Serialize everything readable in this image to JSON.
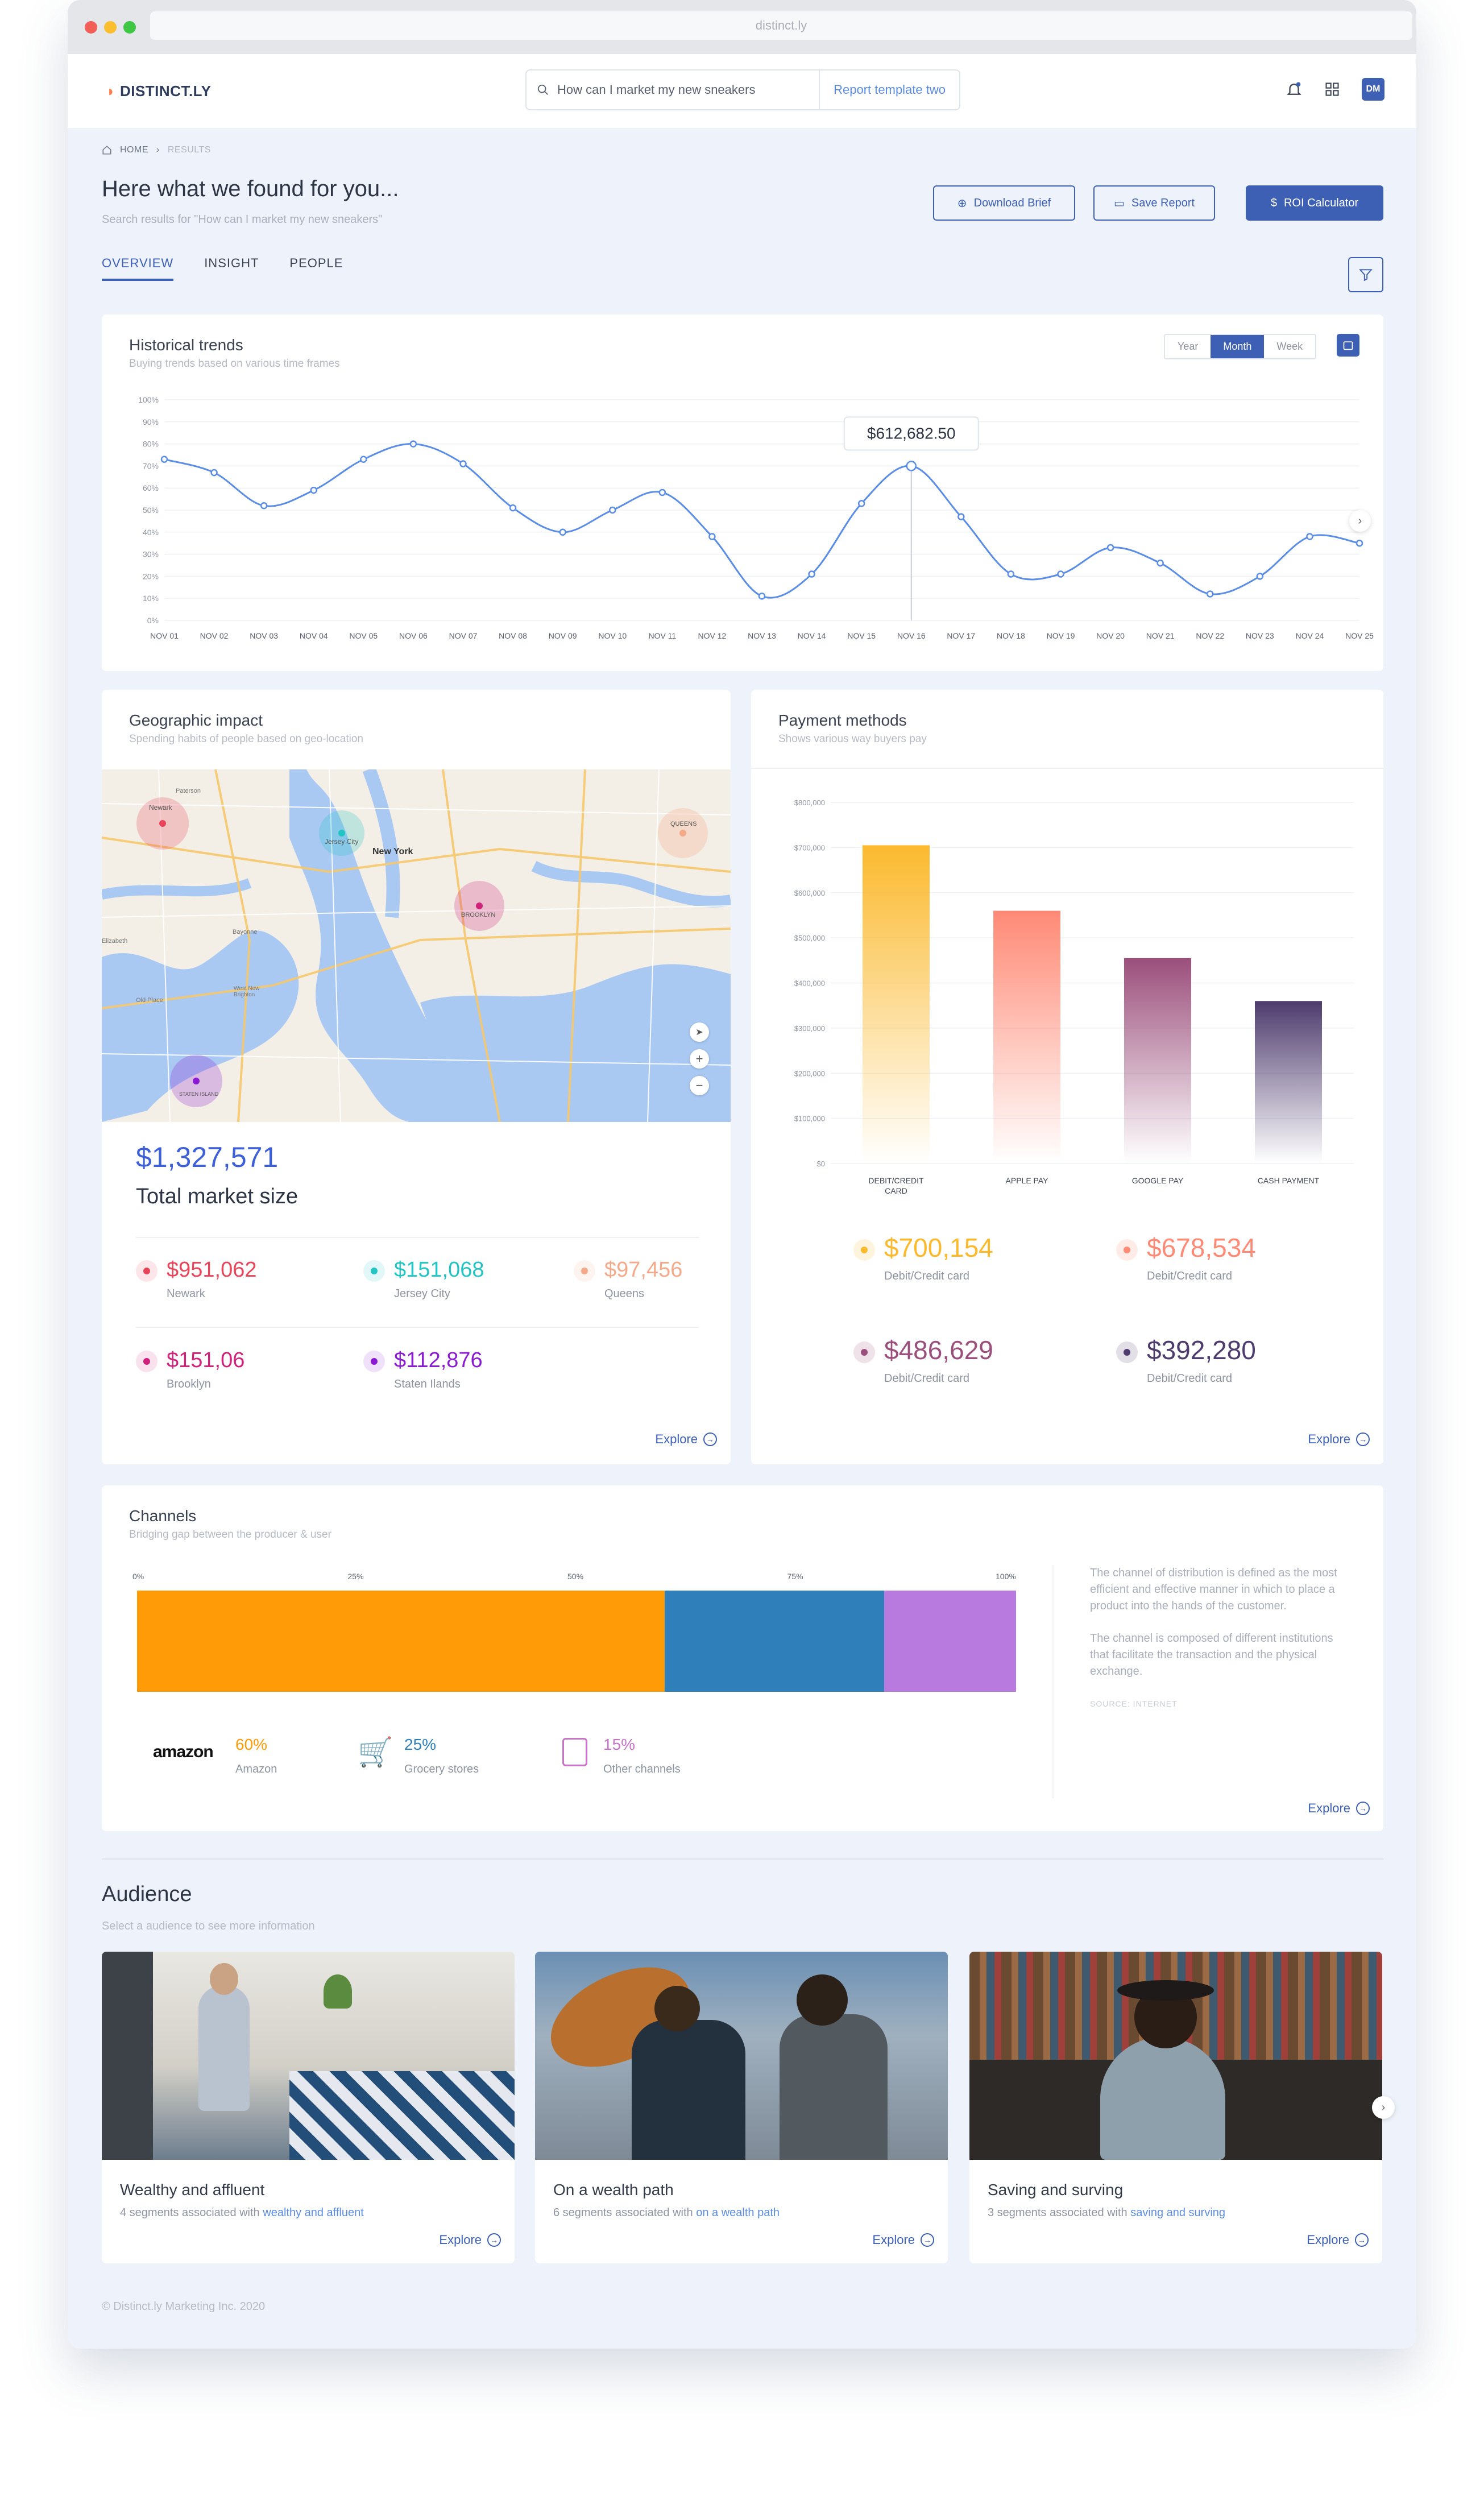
{
  "browser": {
    "url": "distinct.ly"
  },
  "header": {
    "logo": "DISTINCT.LY",
    "search_value": "How can I market my new sneakers",
    "template": "Report template two",
    "avatar": "DM"
  },
  "breadcrumb": {
    "home": "HOME",
    "current": "RESULTS"
  },
  "page": {
    "title": "Here what we found for you...",
    "subtitle": "Search results for \"How can I market my new sneakers\""
  },
  "actions": {
    "download": "Download Brief",
    "save": "Save Report",
    "roi": "ROI Calculator"
  },
  "tabs": [
    "OVERVIEW",
    "INSIGHT",
    "PEOPLE"
  ],
  "trends": {
    "title": "Historical trends",
    "subtitle": "Buying trends based on various time frames",
    "ranges": [
      "Year",
      "Month",
      "Week"
    ],
    "active": "Month",
    "tooltip": "$612,682.50"
  },
  "chart_data": {
    "type": "line",
    "x": [
      "NOV 01",
      "NOV 02",
      "NOV 03",
      "NOV 04",
      "NOV 05",
      "NOV 06",
      "NOV 07",
      "NOV 08",
      "NOV 09",
      "NOV 10",
      "NOV 11",
      "NOV 12",
      "NOV 13",
      "NOV 14",
      "NOV 15",
      "NOV 16",
      "NOV 17",
      "NOV 18",
      "NOV 19",
      "NOV 20",
      "NOV 21",
      "NOV 22",
      "NOV 23",
      "NOV 24",
      "NOV 25"
    ],
    "values": [
      73,
      67,
      52,
      59,
      73,
      80,
      71,
      51,
      40,
      50,
      58,
      38,
      11,
      21,
      53,
      70,
      47,
      21,
      21,
      33,
      26,
      12,
      20,
      38,
      35
    ],
    "yticks": [
      "0%",
      "10%",
      "20%",
      "30%",
      "40%",
      "50%",
      "60%",
      "70%",
      "80%",
      "90%",
      "100%"
    ],
    "ylim": [
      0,
      100
    ],
    "highlight_index": 15,
    "grid": true
  },
  "geo": {
    "title": "Geographic impact",
    "subtitle": "Spending habits of people based on geo-location",
    "total": "$1,327,571",
    "total_label": "Total market size",
    "map_labels": {
      "city": "New York",
      "markers": [
        "Newark",
        "Jersey City",
        "QUEENS",
        "BROOKLYN",
        "STATEN ISLAND"
      ],
      "places": [
        "Paterson",
        "Bayonne",
        "Elizabeth",
        "Old Place",
        "West New Brighton"
      ]
    },
    "items": [
      {
        "value": "$951,062",
        "label": "Newark",
        "color": "#e8455b"
      },
      {
        "value": "$151,068",
        "label": "Jersey City",
        "color": "#22c4c4"
      },
      {
        "value": "$97,456",
        "label": "Queens",
        "color": "#f4a98a"
      },
      {
        "value": "$151,06",
        "label": "Brooklyn",
        "color": "#d0217b"
      },
      {
        "value": "$112,876",
        "label": "Staten Ilands",
        "color": "#8a1bd3"
      }
    ],
    "explore": "Explore"
  },
  "payment": {
    "title": "Payment methods",
    "subtitle": "Shows various way buyers pay",
    "explore": "Explore",
    "yticks": [
      "$0",
      "$100,000",
      "$200,000",
      "$300,000",
      "$400,000",
      "$500,000",
      "$600,000",
      "$700,000",
      "$800,000"
    ],
    "ylim": [
      0,
      800000
    ],
    "bars": [
      {
        "name": "DEBIT/CREDIT CARD",
        "value": 705000,
        "top": "#fbb92e"
      },
      {
        "name": "APPLE PAY",
        "value": 560000,
        "top": "#ff8a76"
      },
      {
        "name": "GOOGLE PAY",
        "value": 455000,
        "top": "#9b4f7c"
      },
      {
        "name": "CASH PAYMENT",
        "value": 360000,
        "top": "#4e3c6e"
      }
    ],
    "stats": [
      {
        "value": "$700,154",
        "label": "Debit/Credit card",
        "color": "#fbb92e"
      },
      {
        "value": "$678,534",
        "label": "Debit/Credit card",
        "color": "#ff8a76"
      },
      {
        "value": "$486,629",
        "label": "Debit/Credit card",
        "color": "#9b4f7c"
      },
      {
        "value": "$392,280",
        "label": "Debit/Credit card",
        "color": "#4e3c6e"
      }
    ]
  },
  "channels": {
    "title": "Channels",
    "subtitle": "Bridging gap between the producer & user",
    "ticks": [
      "0%",
      "25%",
      "50%",
      "75%",
      "100%"
    ],
    "segments": [
      {
        "value": 0.6,
        "color": "#ff9b06"
      },
      {
        "value": 0.25,
        "color": "#2f80ba"
      },
      {
        "value": 0.15,
        "color": "#b97ae0"
      }
    ],
    "legend": [
      {
        "pct": "60%",
        "name": "Amazon",
        "color": "#ff9b06",
        "logo": "amazon"
      },
      {
        "pct": "25%",
        "name": "Grocery stores",
        "color": "#2f80ba"
      },
      {
        "pct": "15%",
        "name": "Other channels",
        "color": "#c873c8"
      }
    ],
    "desc1": "The channel of distribution is defined as the most efficient and effective manner in which to place a product into the hands of the customer.",
    "desc2": "The channel is composed of different institutions that facilitate the transaction and the physical exchange.",
    "source": "SOURCE: INTERNET",
    "explore": "Explore"
  },
  "audience": {
    "title": "Audience",
    "subtitle": "Select a audience to see more information",
    "cards": [
      {
        "title": "Wealthy and affluent",
        "prefix": "4 segments associated with",
        "link": "wealthy and affluent"
      },
      {
        "title": "On a wealth path",
        "prefix": "6 segments associated with",
        "link": "on a wealth path"
      },
      {
        "title": "Saving and surving",
        "prefix": "3 segments associated with",
        "link": "saving and surving"
      }
    ],
    "explore": "Explore"
  },
  "footer": "© Distinct.ly Marketing Inc. 2020"
}
